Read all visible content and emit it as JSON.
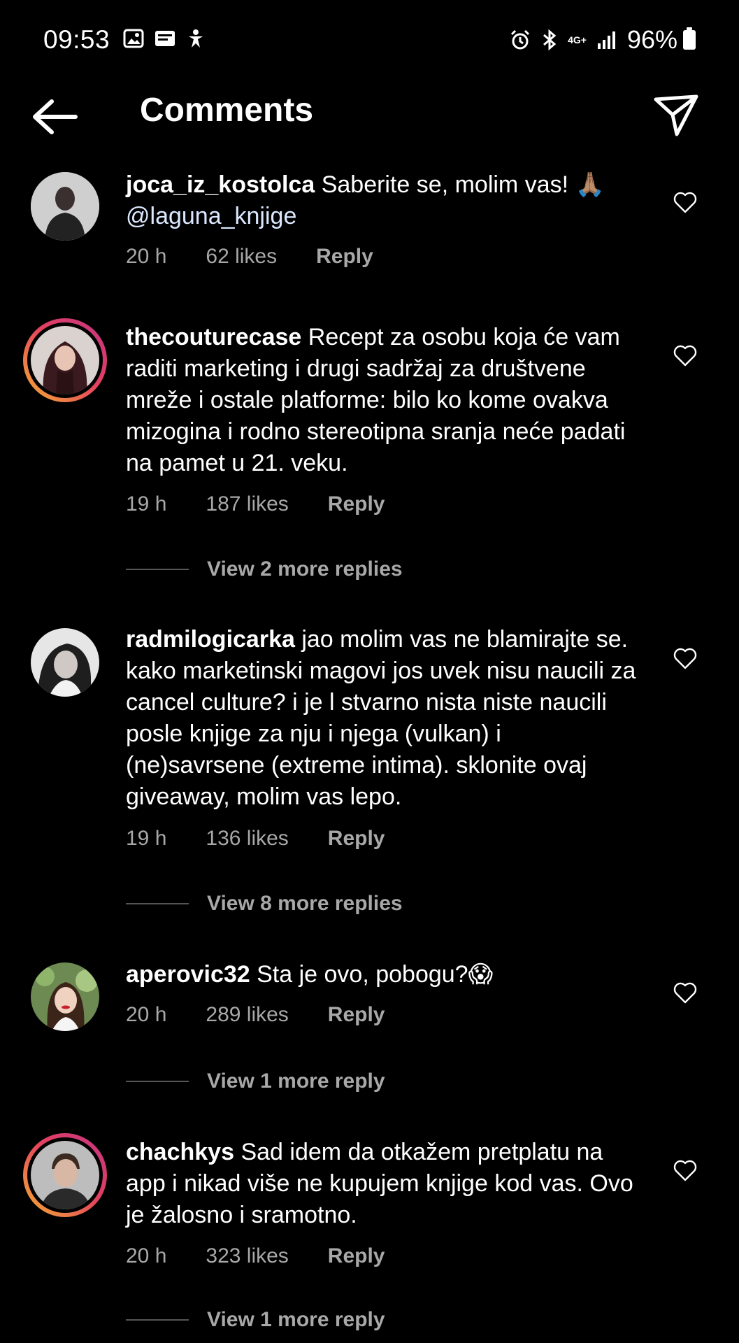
{
  "status": {
    "time": "09:53",
    "network": "4G+",
    "battery": "96%"
  },
  "header": {
    "title": "Comments"
  },
  "comments": [
    {
      "user": "joca_iz_kostolca",
      "text": "Saberite se, molim vas! 🙏🏽",
      "mention": "@laguna_knjige",
      "time": "20 h",
      "likes": "62 likes",
      "reply": "Reply"
    },
    {
      "user": "thecouturecase",
      "text": "Recept za osobu koja će vam raditi marketing i drugi sadržaj za društvene mreže i ostale platforme: bilo ko kome ovakva mizogina i rodno stereotipna sranja neće padati na pamet u 21. veku.",
      "time": "19 h",
      "likes": "187 likes",
      "reply": "Reply",
      "more": "View 2 more replies"
    },
    {
      "user": "radmilogicarka",
      "text": "jao molim vas ne blamirajte se. kako marketinski magovi jos uvek nisu naucili za cancel culture? i je l stvarno nista niste naucili posle knjige za nju i njega (vulkan) i (ne)savrsene (extreme intima). sklonite ovaj giveaway, molim vas lepo.",
      "time": "19 h",
      "likes": "136 likes",
      "reply": "Reply",
      "more": "View 8 more replies"
    },
    {
      "user": "aperovic32",
      "text": "Sta je ovo, pobogu?😱",
      "time": "20 h",
      "likes": "289 likes",
      "reply": "Reply",
      "more": "View 1 more reply"
    },
    {
      "user": "chachkys",
      "text": "Sad idem da otkažem pretplatu na app i nikad više ne kupujem knjige kod vas. Ovo je žalosno i sramotno.",
      "time": "20 h",
      "likes": "323 likes",
      "reply": "Reply",
      "more": "View 1 more reply"
    }
  ],
  "colors": {
    "background": "#000000",
    "meta": "#a8a8a8",
    "story_ring": "#e4405f"
  },
  "icons": [
    "back-arrow-icon",
    "send-icon",
    "heart-icon",
    "alarm-icon",
    "bluetooth-icon",
    "signal-icon",
    "battery-icon",
    "gallery-icon"
  ]
}
